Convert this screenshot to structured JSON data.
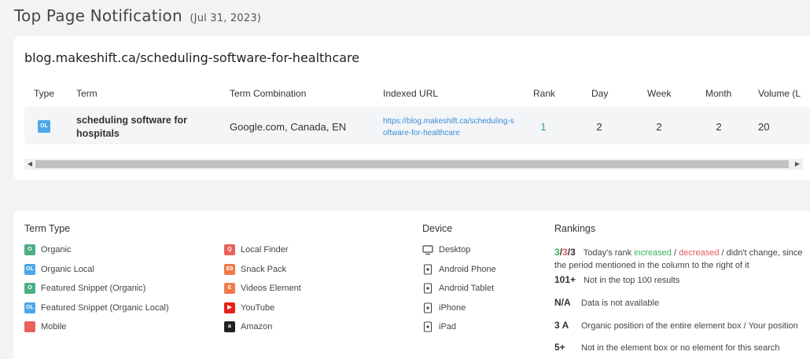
{
  "header": {
    "title": "Top Page Notification",
    "date": "(Jul 31, 2023)"
  },
  "report": {
    "site": "blog.makeshift.ca/scheduling-software-for-healthcare",
    "columns": [
      "Type",
      "Term",
      "Term Combination",
      "Indexed URL",
      "Rank",
      "Day",
      "Week",
      "Month",
      "Volume (L"
    ],
    "rows": [
      {
        "type_badge": "OL",
        "term": "scheduling software for hospitals",
        "combination": "Google.com, Canada, EN",
        "url": "https://blog.makeshift.ca/scheduling-software-for-healthcare",
        "rank": "1",
        "day": "2",
        "week": "2",
        "month": "2",
        "volume": "20"
      }
    ]
  },
  "legend": {
    "term_type_title": "Term Type",
    "term_types_col1": [
      {
        "icon": "organic-icon",
        "glyph": "O",
        "color": "#4caf84",
        "label": "Organic"
      },
      {
        "icon": "organic-local-icon",
        "glyph": "OL",
        "color": "#4da6e8",
        "label": "Organic Local"
      },
      {
        "icon": "featured-snippet-icon",
        "glyph": "O",
        "color": "#4caf84",
        "label": "Featured Snippet (Organic)"
      },
      {
        "icon": "featured-snippet-local-icon",
        "glyph": "OL",
        "color": "#4da6e8",
        "label": "Featured Snippet (Organic Local)"
      },
      {
        "icon": "mobile-icon",
        "glyph": "",
        "color": "#e8615a",
        "label": "Mobile"
      }
    ],
    "term_types_col2": [
      {
        "icon": "local-finder-icon",
        "glyph": "Q",
        "color": "#e8615a",
        "label": "Local Finder"
      },
      {
        "icon": "snack-pack-icon",
        "glyph": "E9",
        "color": "#f07a4a",
        "label": "Snack Pack"
      },
      {
        "icon": "videos-element-icon",
        "glyph": "E",
        "color": "#f07a4a",
        "label": "Videos Element"
      },
      {
        "icon": "youtube-icon",
        "glyph": "▶",
        "color": "#e62117",
        "label": "YouTube"
      },
      {
        "icon": "amazon-icon",
        "glyph": "a",
        "color": "#222222",
        "label": "Amazon"
      }
    ],
    "device_title": "Device",
    "devices": [
      {
        "icon": "desktop-icon",
        "label": "Desktop"
      },
      {
        "icon": "android-phone-icon",
        "label": "Android Phone"
      },
      {
        "icon": "android-tablet-icon",
        "label": "Android Tablet"
      },
      {
        "icon": "iphone-icon",
        "label": "iPhone"
      },
      {
        "icon": "ipad-icon",
        "label": "iPad"
      }
    ],
    "rankings_title": "Rankings",
    "rank_change": {
      "up": "3",
      "slash1": "/",
      "down": "3",
      "slash2": "/",
      "same": "3",
      "text_a": "Today's rank ",
      "increased": "increased",
      "text_b": " / ",
      "decreased": "decreased",
      "text_c": " / didn't change, since",
      "line2": "the period mentioned in the column to the right of it"
    },
    "rankings": [
      {
        "key": "101+",
        "desc": "Not in the top 100 results"
      },
      {
        "key": "N/A",
        "desc": "Data is not available"
      },
      {
        "key": "3 A",
        "desc": "Organic position of the entire element box / Your position"
      },
      {
        "key": "5+",
        "desc": "Not in the element box or no element for this search"
      }
    ],
    "colors": {
      "green": "#3bb25a",
      "red": "#e55a5a",
      "link": "#3a8ed8"
    }
  }
}
